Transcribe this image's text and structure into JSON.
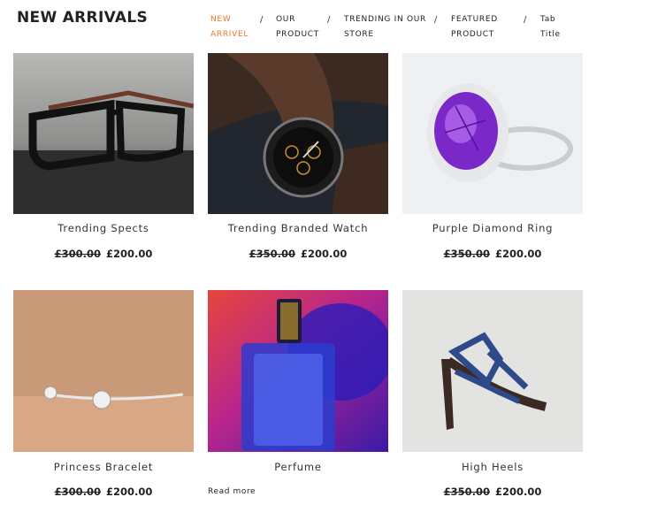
{
  "section_title": "NEW ARRIVALS",
  "tabs": [
    {
      "line1": "NEW",
      "line2": "ARRIVEL"
    },
    {
      "line1": "OUR",
      "line2": "PRODUCT"
    },
    {
      "line1": "TRENDING IN OUR",
      "line2": "STORE"
    },
    {
      "line1": "FEATURED",
      "line2": "PRODUCT"
    },
    {
      "line1": "Tab",
      "line2": "Title"
    }
  ],
  "separator": "/",
  "products": [
    {
      "name": "Trending Spects",
      "old_price": "£300.00",
      "price": "£200.00"
    },
    {
      "name": "Trending Branded Watch",
      "old_price": "£350.00",
      "price": "£200.00"
    },
    {
      "name": "Purple Diamond Ring",
      "old_price": "£350.00",
      "price": "£200.00"
    },
    {
      "name": "Princess Bracelet",
      "old_price": "£300.00",
      "price": "£200.00"
    },
    {
      "name": "Perfume",
      "link": "Read more"
    },
    {
      "name": "High Heels",
      "old_price": "£350.00",
      "price": "£200.00"
    }
  ],
  "colors": {
    "active_tab": "#e8782a",
    "text": "#222222"
  }
}
